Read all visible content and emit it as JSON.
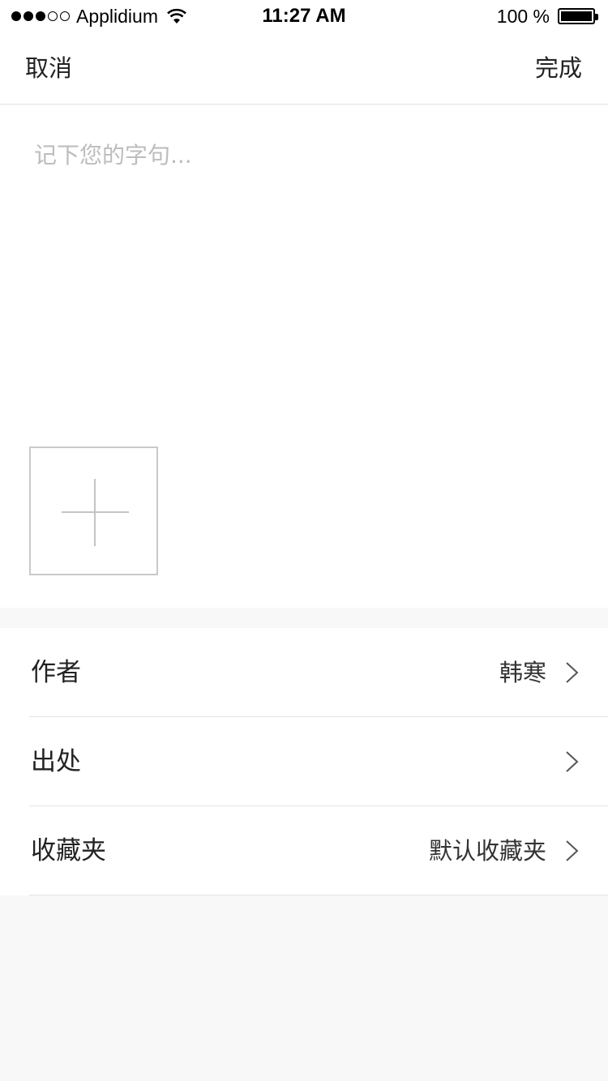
{
  "status_bar": {
    "carrier": "Applidium",
    "time": "11:27 AM",
    "battery": "100 %"
  },
  "nav": {
    "cancel_label": "取消",
    "done_label": "完成"
  },
  "editor": {
    "placeholder": "记下您的字句..."
  },
  "rows": [
    {
      "label": "作者",
      "value": "韩寒"
    },
    {
      "label": "出处",
      "value": ""
    },
    {
      "label": "收藏夹",
      "value": "默认收藏夹"
    }
  ]
}
